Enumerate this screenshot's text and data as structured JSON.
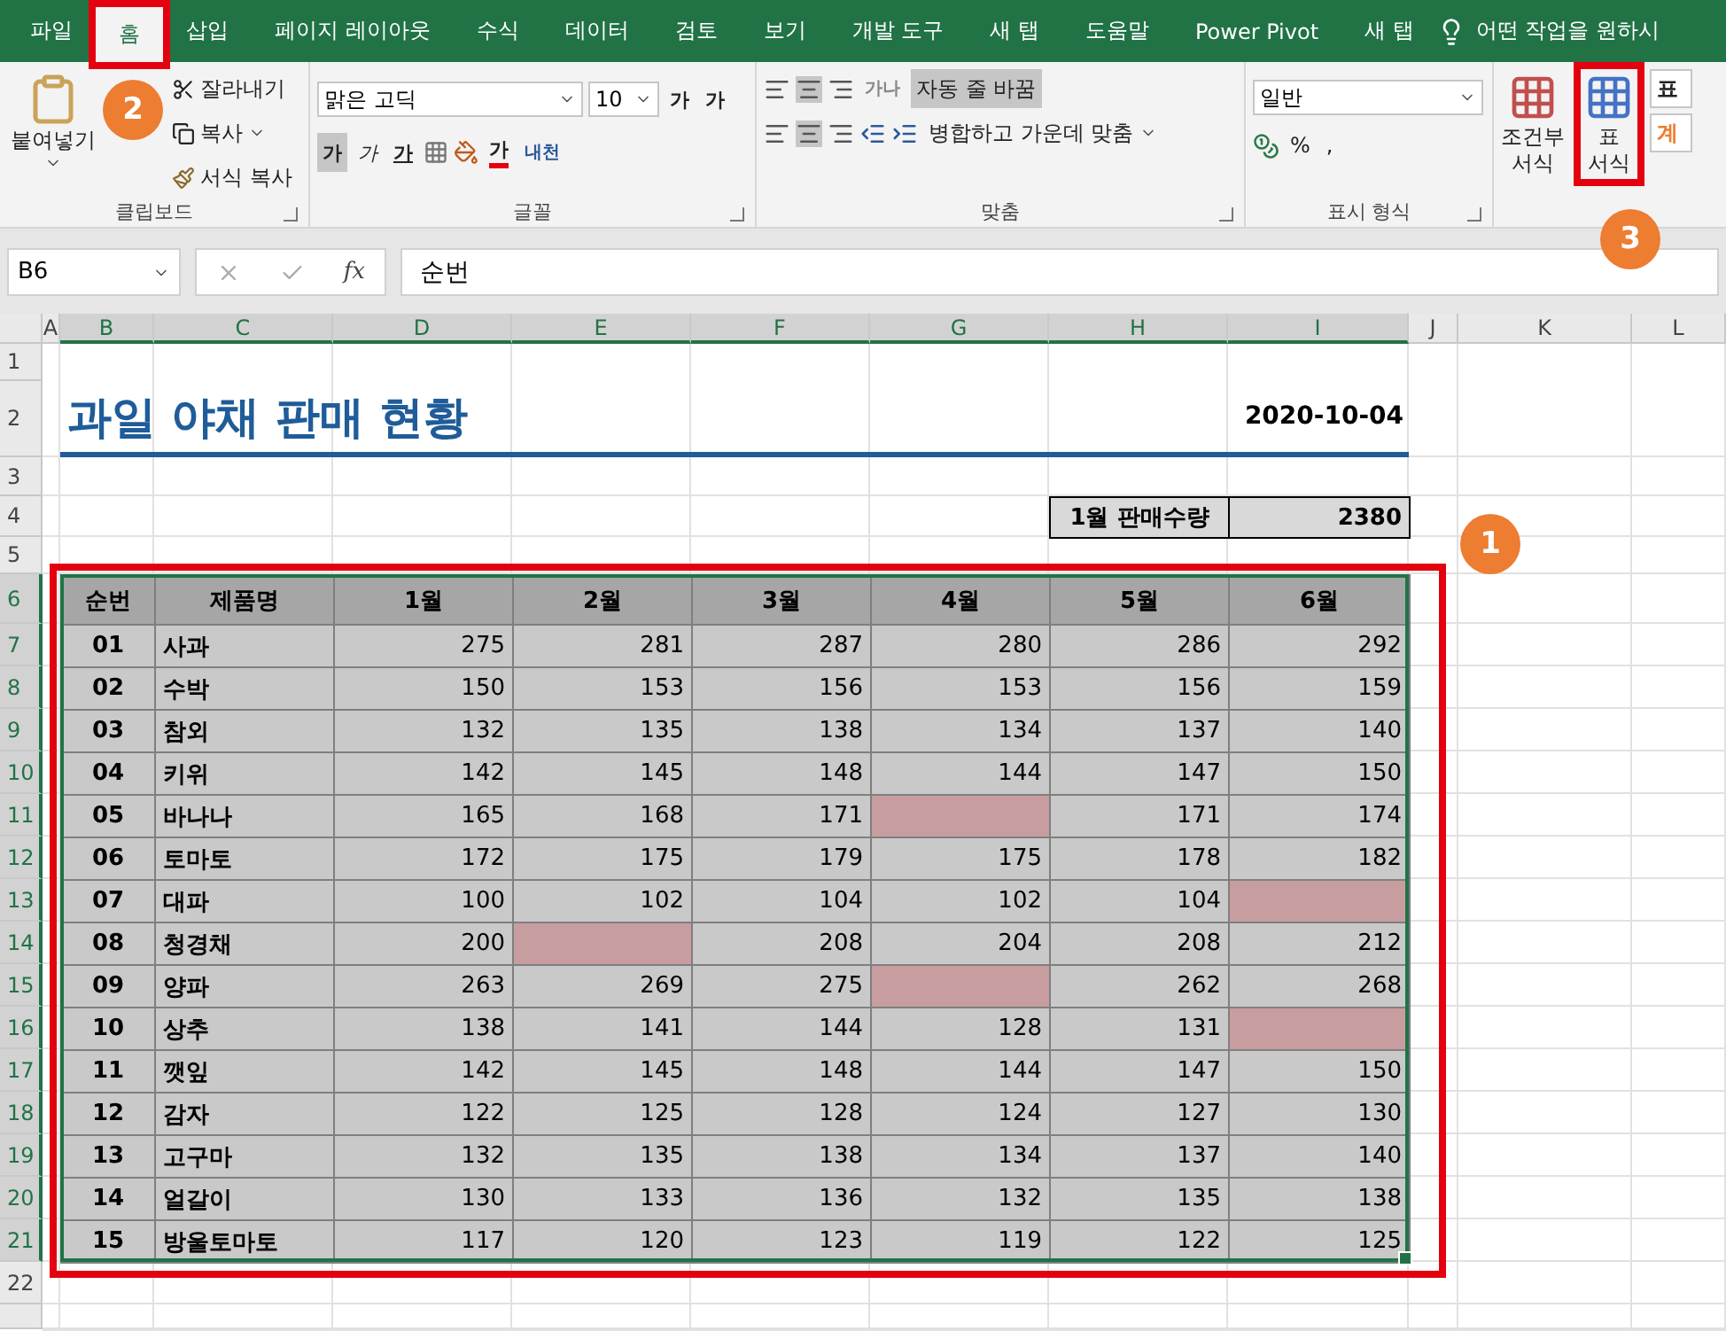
{
  "tabs": [
    {
      "label": "파일",
      "selected": false
    },
    {
      "label": "홈",
      "selected": true
    },
    {
      "label": "삽입",
      "selected": false
    },
    {
      "label": "페이지 레이아웃",
      "selected": false
    },
    {
      "label": "수식",
      "selected": false
    },
    {
      "label": "데이터",
      "selected": false
    },
    {
      "label": "검토",
      "selected": false
    },
    {
      "label": "보기",
      "selected": false
    },
    {
      "label": "개발 도구",
      "selected": false
    },
    {
      "label": "새 탭",
      "selected": false
    },
    {
      "label": "도움말",
      "selected": false
    },
    {
      "label": "Power Pivot",
      "selected": false
    },
    {
      "label": "새 탭",
      "selected": false
    }
  ],
  "tell_me": "어떤 작업을 원하시",
  "ribbon": {
    "clipboard": {
      "paste": "붙여넣기",
      "cut": "잘라내기",
      "copy": "복사",
      "format_painter": "서식 복사",
      "label": "클립보드"
    },
    "font": {
      "name": "맑은 고딕",
      "size": "10",
      "grow": "가",
      "shrink": "가",
      "bold": "가",
      "italic": "가",
      "underline": "가",
      "font_color": "가",
      "phonetic": "내천",
      "label": "글꼴"
    },
    "alignment": {
      "orientation": "가나",
      "wrap_text": "자동 줄 바꿈",
      "wrap_on": true,
      "merge": "병합하고 가운데 맞춤",
      "label": "맞춤"
    },
    "number": {
      "format": "일반",
      "percent": "%",
      "comma": ",",
      "label": "표시 형식"
    },
    "styles": {
      "conditional": [
        "조건부",
        "서식"
      ],
      "table_format": [
        "표",
        "서식"
      ],
      "cell_style": "표",
      "style_calc": "계"
    }
  },
  "formula_bar": {
    "name_box": "B6",
    "function_label": "fx",
    "value": "순번"
  },
  "columns": [
    {
      "label": "A",
      "selected": false
    },
    {
      "label": "B",
      "selected": true
    },
    {
      "label": "C",
      "selected": true
    },
    {
      "label": "D",
      "selected": true
    },
    {
      "label": "E",
      "selected": true
    },
    {
      "label": "F",
      "selected": true
    },
    {
      "label": "G",
      "selected": true
    },
    {
      "label": "H",
      "selected": true
    },
    {
      "label": "I",
      "selected": true
    },
    {
      "label": "J",
      "selected": false
    },
    {
      "label": "K",
      "selected": false
    },
    {
      "label": "L",
      "selected": false
    }
  ],
  "row_numbers": [
    {
      "label": "1",
      "selected": false
    },
    {
      "label": "2",
      "selected": false
    },
    {
      "label": "3",
      "selected": false
    },
    {
      "label": "4",
      "selected": false
    },
    {
      "label": "5",
      "selected": false
    },
    {
      "label": "6",
      "selected": true
    },
    {
      "label": "7",
      "selected": true
    },
    {
      "label": "8",
      "selected": true
    },
    {
      "label": "9",
      "selected": true
    },
    {
      "label": "10",
      "selected": true
    },
    {
      "label": "11",
      "selected": true
    },
    {
      "label": "12",
      "selected": true
    },
    {
      "label": "13",
      "selected": true
    },
    {
      "label": "14",
      "selected": true
    },
    {
      "label": "15",
      "selected": true
    },
    {
      "label": "16",
      "selected": true
    },
    {
      "label": "17",
      "selected": true
    },
    {
      "label": "18",
      "selected": true
    },
    {
      "label": "19",
      "selected": true
    },
    {
      "label": "20",
      "selected": true
    },
    {
      "label": "21",
      "selected": true
    },
    {
      "label": "22",
      "selected": false
    }
  ],
  "sheet": {
    "title": "과일 야채 판매 현황",
    "date": "2020-10-04",
    "summary_label": "1월 판매수량",
    "summary_value": "2380"
  },
  "table": {
    "columns": [
      "순번",
      "제품명",
      "1월",
      "2월",
      "3월",
      "4월",
      "5월",
      "6월"
    ],
    "rows": [
      {
        "number": "01",
        "name": "사과",
        "cells": [
          {
            "value": "275",
            "highlighted": false
          },
          {
            "value": "281",
            "highlighted": false
          },
          {
            "value": "287",
            "highlighted": false
          },
          {
            "value": "280",
            "highlighted": false
          },
          {
            "value": "286",
            "highlighted": false
          },
          {
            "value": "292",
            "highlighted": false
          }
        ]
      },
      {
        "number": "02",
        "name": "수박",
        "cells": [
          {
            "value": "150",
            "highlighted": false
          },
          {
            "value": "153",
            "highlighted": false
          },
          {
            "value": "156",
            "highlighted": false
          },
          {
            "value": "153",
            "highlighted": false
          },
          {
            "value": "156",
            "highlighted": false
          },
          {
            "value": "159",
            "highlighted": false
          }
        ]
      },
      {
        "number": "03",
        "name": "참외",
        "cells": [
          {
            "value": "132",
            "highlighted": false
          },
          {
            "value": "135",
            "highlighted": false
          },
          {
            "value": "138",
            "highlighted": false
          },
          {
            "value": "134",
            "highlighted": false
          },
          {
            "value": "137",
            "highlighted": false
          },
          {
            "value": "140",
            "highlighted": false
          }
        ]
      },
      {
        "number": "04",
        "name": "키위",
        "cells": [
          {
            "value": "142",
            "highlighted": false
          },
          {
            "value": "145",
            "highlighted": false
          },
          {
            "value": "148",
            "highlighted": false
          },
          {
            "value": "144",
            "highlighted": false
          },
          {
            "value": "147",
            "highlighted": false
          },
          {
            "value": "150",
            "highlighted": false
          }
        ]
      },
      {
        "number": "05",
        "name": "바나나",
        "cells": [
          {
            "value": "165",
            "highlighted": false
          },
          {
            "value": "168",
            "highlighted": false
          },
          {
            "value": "171",
            "highlighted": false
          },
          {
            "highlighted": true
          },
          {
            "value": "171",
            "highlighted": false
          },
          {
            "value": "174",
            "highlighted": false
          }
        ]
      },
      {
        "number": "06",
        "name": "토마토",
        "cells": [
          {
            "value": "172",
            "highlighted": false
          },
          {
            "value": "175",
            "highlighted": false
          },
          {
            "value": "179",
            "highlighted": false
          },
          {
            "value": "175",
            "highlighted": false
          },
          {
            "value": "178",
            "highlighted": false
          },
          {
            "value": "182",
            "highlighted": false
          }
        ]
      },
      {
        "number": "07",
        "name": "대파",
        "cells": [
          {
            "value": "100",
            "highlighted": false
          },
          {
            "value": "102",
            "highlighted": false
          },
          {
            "value": "104",
            "highlighted": false
          },
          {
            "value": "102",
            "highlighted": false
          },
          {
            "value": "104",
            "highlighted": false
          },
          {
            "highlighted": true
          }
        ]
      },
      {
        "number": "08",
        "name": "청경채",
        "cells": [
          {
            "value": "200",
            "highlighted": false
          },
          {
            "highlighted": true
          },
          {
            "value": "208",
            "highlighted": false
          },
          {
            "value": "204",
            "highlighted": false
          },
          {
            "value": "208",
            "highlighted": false
          },
          {
            "value": "212",
            "highlighted": false
          }
        ]
      },
      {
        "number": "09",
        "name": "양파",
        "cells": [
          {
            "value": "263",
            "highlighted": false
          },
          {
            "value": "269",
            "highlighted": false
          },
          {
            "value": "275",
            "highlighted": false
          },
          {
            "highlighted": true
          },
          {
            "value": "262",
            "highlighted": false
          },
          {
            "value": "268",
            "highlighted": false
          }
        ]
      },
      {
        "number": "10",
        "name": "상추",
        "cells": [
          {
            "value": "138",
            "highlighted": false
          },
          {
            "value": "141",
            "highlighted": false
          },
          {
            "value": "144",
            "highlighted": false
          },
          {
            "value": "128",
            "highlighted": false
          },
          {
            "value": "131",
            "highlighted": false
          },
          {
            "highlighted": true
          }
        ]
      },
      {
        "number": "11",
        "name": "깻잎",
        "cells": [
          {
            "value": "142",
            "highlighted": false
          },
          {
            "value": "145",
            "highlighted": false
          },
          {
            "value": "148",
            "highlighted": false
          },
          {
            "value": "144",
            "highlighted": false
          },
          {
            "value": "147",
            "highlighted": false
          },
          {
            "value": "150",
            "highlighted": false
          }
        ]
      },
      {
        "number": "12",
        "name": "감자",
        "cells": [
          {
            "value": "122",
            "highlighted": false
          },
          {
            "value": "125",
            "highlighted": false
          },
          {
            "value": "128",
            "highlighted": false
          },
          {
            "value": "124",
            "highlighted": false
          },
          {
            "value": "127",
            "highlighted": false
          },
          {
            "value": "130",
            "highlighted": false
          }
        ]
      },
      {
        "number": "13",
        "name": "고구마",
        "cells": [
          {
            "value": "132",
            "highlighted": false
          },
          {
            "value": "135",
            "highlighted": false
          },
          {
            "value": "138",
            "highlighted": false
          },
          {
            "value": "134",
            "highlighted": false
          },
          {
            "value": "137",
            "highlighted": false
          },
          {
            "value": "140",
            "highlighted": false
          }
        ]
      },
      {
        "number": "14",
        "name": "얼갈이",
        "cells": [
          {
            "value": "130",
            "highlighted": false
          },
          {
            "value": "133",
            "highlighted": false
          },
          {
            "value": "136",
            "highlighted": false
          },
          {
            "value": "132",
            "highlighted": false
          },
          {
            "value": "135",
            "highlighted": false
          },
          {
            "value": "138",
            "highlighted": false
          }
        ]
      },
      {
        "number": "15",
        "name": "방울토마토",
        "cells": [
          {
            "value": "117",
            "highlighted": false
          },
          {
            "value": "120",
            "highlighted": false
          },
          {
            "value": "123",
            "highlighted": false
          },
          {
            "value": "119",
            "highlighted": false
          },
          {
            "value": "122",
            "highlighted": false
          },
          {
            "value": "125",
            "highlighted": false
          }
        ]
      }
    ]
  },
  "annotations": [
    {
      "label": "1"
    },
    {
      "label": "2"
    },
    {
      "label": "3"
    }
  ]
}
